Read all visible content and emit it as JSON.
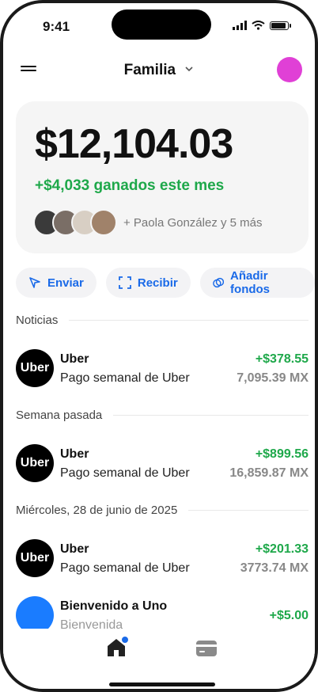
{
  "status": {
    "time": "9:41"
  },
  "header": {
    "title": "Familia"
  },
  "account": {
    "balance": "$12,104.03",
    "earned": "+$4,033 ganados este mes",
    "members_label": "+ Paola González y 5 más"
  },
  "actions": {
    "send": "Enviar",
    "receive": "Recibir",
    "add_funds": "Añadir fondos"
  },
  "sections": {
    "news": "Noticias",
    "last_week": "Semana pasada",
    "date": "Miércoles, 28 de junio de 2025"
  },
  "transactions": [
    {
      "logo": "Uber",
      "name": "Uber",
      "desc": "Pago semanal de Uber",
      "amount": "+$378.55",
      "sub": "7,095.39 MX"
    },
    {
      "logo": "Uber",
      "name": "Uber",
      "desc": "Pago semanal de Uber",
      "amount": "+$899.56",
      "sub": "16,859.87 MX"
    },
    {
      "logo": "Uber",
      "name": "Uber",
      "desc": "Pago semanal de Uber",
      "amount": "+$201.33",
      "sub": "3773.74 MX"
    },
    {
      "name": "Bienvenido a Uno",
      "desc": "Bienvenida",
      "amount": "+$5.00"
    }
  ],
  "colors": {
    "accent": "#1a6ae8",
    "positive": "#1ea84a",
    "avatar": "#e040d6",
    "welcome_logo": "#1a7cff"
  },
  "icons": [
    "menu-icon",
    "chevron-down-icon",
    "send-icon",
    "scan-icon",
    "add-funds-icon",
    "home-icon",
    "card-icon",
    "signal-icon",
    "wifi-icon",
    "battery-icon"
  ]
}
